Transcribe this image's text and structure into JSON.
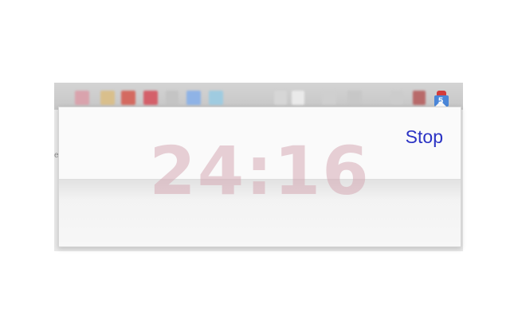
{
  "popup": {
    "timer_text": "24:16",
    "stop_label": "Stop"
  },
  "toolbar": {
    "extension_icon": "timer-extension-icon",
    "tile_colors": [
      "#d9a3ad",
      "#d9bf8c",
      "#d46a60",
      "#d4606a",
      "#bdbdbd",
      "#8fb3e6",
      "#9fcbe0",
      "#d6d6d6",
      "#e6e6e6",
      "#cfcfcf",
      "#c7c7c7",
      "#b86a6a"
    ]
  },
  "colors": {
    "stop_link": "#2b33c4",
    "timer_text": "#d6aab4"
  }
}
